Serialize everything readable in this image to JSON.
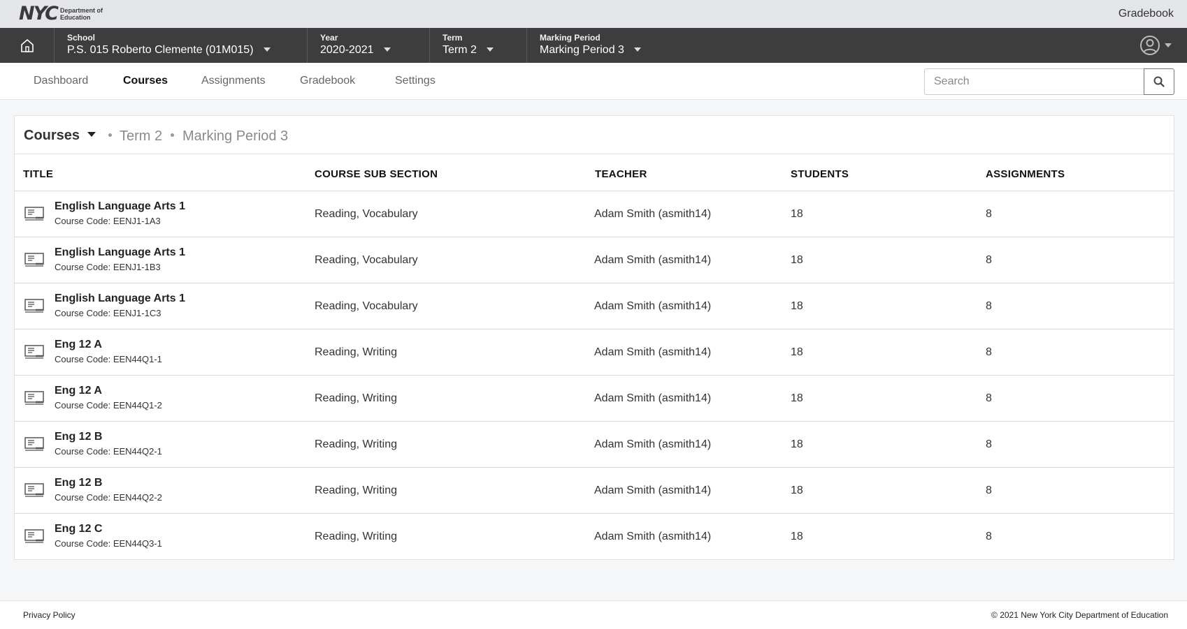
{
  "brand": {
    "logo_mark": "NYC",
    "logo_text": "Department of Education",
    "app_title": "Gradebook"
  },
  "selectors": {
    "school": {
      "label": "School",
      "value": "P.S. 015 Roberto Clemente (01M015)"
    },
    "year": {
      "label": "Year",
      "value": "2020-2021"
    },
    "term": {
      "label": "Term",
      "value": "Term 2"
    },
    "marking_period": {
      "label": "Marking Period",
      "value": "Marking Period 3"
    }
  },
  "nav": {
    "items": [
      {
        "label": "Dashboard",
        "active": false
      },
      {
        "label": "Courses",
        "active": true
      },
      {
        "label": "Assignments",
        "active": false
      },
      {
        "label": "Gradebook",
        "active": false
      },
      {
        "label": "Settings",
        "active": false
      }
    ],
    "search_placeholder": "Search"
  },
  "card": {
    "title": "Courses",
    "term": "Term 2",
    "marking_period": "Marking Period 3"
  },
  "table": {
    "headers": [
      "TITLE",
      "COURSE SUB SECTION",
      "TEACHER",
      "STUDENTS",
      "ASSIGNMENTS"
    ],
    "rows": [
      {
        "title": "English Language Arts 1",
        "code": "Course Code: EENJ1-1A3",
        "sub": "Reading, Vocabulary",
        "teacher": "Adam Smith (asmith14)",
        "students": "18",
        "assignments": "8"
      },
      {
        "title": "English Language Arts 1",
        "code": "Course Code: EENJ1-1B3",
        "sub": "Reading, Vocabulary",
        "teacher": "Adam Smith (asmith14)",
        "students": "18",
        "assignments": "8"
      },
      {
        "title": "English Language Arts 1",
        "code": "Course Code: EENJ1-1C3",
        "sub": "Reading, Vocabulary",
        "teacher": "Adam Smith (asmith14)",
        "students": "18",
        "assignments": "8"
      },
      {
        "title": "Eng 12 A",
        "code": "Course Code: EEN44Q1-1",
        "sub": "Reading, Writing",
        "teacher": "Adam Smith (asmith14)",
        "students": "18",
        "assignments": "8"
      },
      {
        "title": "Eng 12 A",
        "code": "Course Code: EEN44Q1-2",
        "sub": "Reading, Writing",
        "teacher": "Adam Smith (asmith14)",
        "students": "18",
        "assignments": "8"
      },
      {
        "title": "Eng 12 B",
        "code": "Course Code: EEN44Q2-1",
        "sub": "Reading, Writing",
        "teacher": "Adam Smith (asmith14)",
        "students": "18",
        "assignments": "8"
      },
      {
        "title": "Eng 12 B",
        "code": "Course Code: EEN44Q2-2",
        "sub": "Reading, Writing",
        "teacher": "Adam Smith (asmith14)",
        "students": "18",
        "assignments": "8"
      },
      {
        "title": "Eng 12 C",
        "code": "Course Code: EEN44Q3-1",
        "sub": "Reading, Writing",
        "teacher": "Adam Smith (asmith14)",
        "students": "18",
        "assignments": "8"
      }
    ]
  },
  "footer": {
    "privacy": "Privacy Policy",
    "copyright": "© 2021 New York City Department of Education"
  },
  "icons": {
    "home": "home-icon",
    "user": "user-circle-icon",
    "search": "search-icon",
    "course": "course-board-icon"
  }
}
